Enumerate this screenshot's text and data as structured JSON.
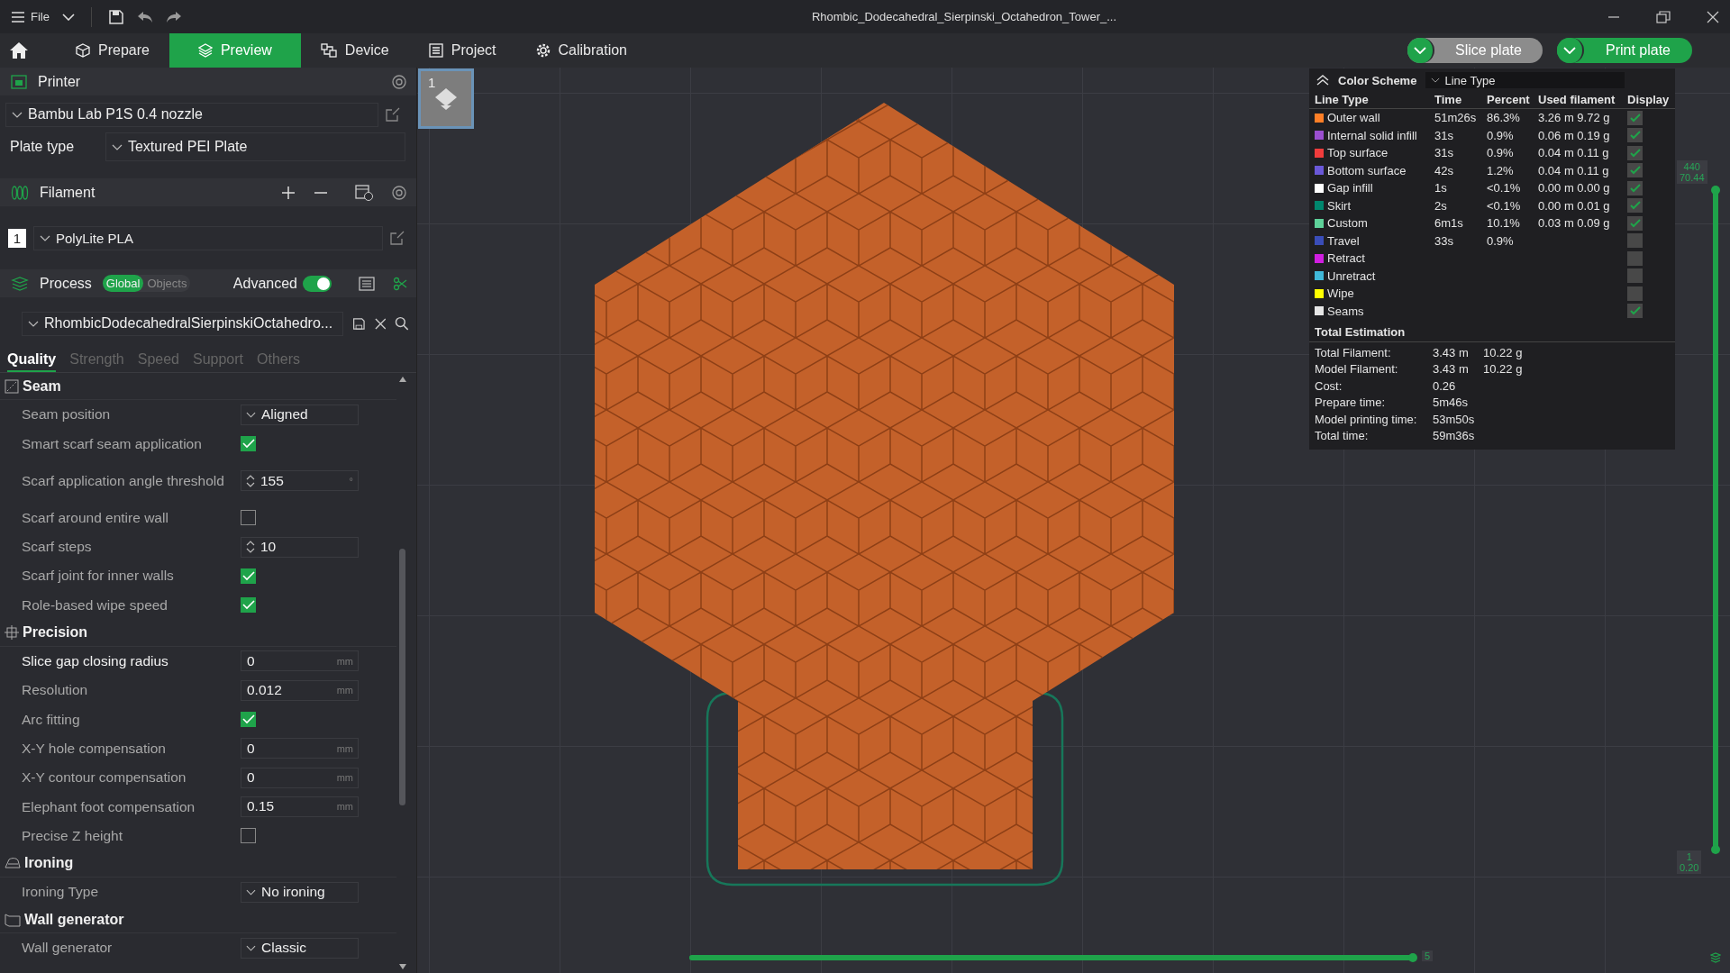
{
  "window": {
    "title": "Rhombic_Dodecahedral_Sierpinski_Octahedron_Tower_..."
  },
  "menu": {
    "label": "File"
  },
  "tabs": [
    {
      "label": "Prepare",
      "selected": false
    },
    {
      "label": "Preview",
      "selected": true
    },
    {
      "label": "Device",
      "selected": false
    },
    {
      "label": "Project",
      "selected": false
    },
    {
      "label": "Calibration",
      "selected": false
    }
  ],
  "actions": [
    {
      "label": "Slice plate",
      "kind": "secondary"
    },
    {
      "label": "Print plate",
      "kind": "primary"
    }
  ],
  "printer": {
    "title": "Printer",
    "preset": "Bambu Lab P1S 0.4 nozzle",
    "plate_type_label": "Plate type",
    "plate_type": "Textured PEI Plate"
  },
  "filament": {
    "title": "Filament",
    "items": [
      {
        "index": "1",
        "name": "PolyLite PLA"
      }
    ]
  },
  "process": {
    "title": "Process",
    "scopes": [
      {
        "label": "Global",
        "selected": true
      },
      {
        "label": "Objects",
        "selected": false
      }
    ],
    "advanced_label": "Advanced",
    "advanced_on": true,
    "preset": "RhombicDodecahedralSierpinskiOctahedro...",
    "tabs": [
      {
        "label": "Quality",
        "selected": true
      },
      {
        "label": "Strength",
        "selected": false
      },
      {
        "label": "Speed",
        "selected": false
      },
      {
        "label": "Support",
        "selected": false
      },
      {
        "label": "Others",
        "selected": false
      }
    ],
    "groups": [
      {
        "title": "Seam",
        "settings": [
          {
            "label": "Seam position",
            "kind": "select",
            "value": "Aligned",
            "highlighted": false
          },
          {
            "label": "Smart scarf seam application",
            "kind": "check",
            "checked": true,
            "highlighted": false
          },
          {
            "label": "Scarf application angle threshold",
            "kind": "spin",
            "value": "155",
            "unit": "°",
            "highlighted": false
          },
          {
            "label": "Scarf around entire wall",
            "kind": "check",
            "checked": false,
            "highlighted": false
          },
          {
            "label": "Scarf steps",
            "kind": "spin",
            "value": "10",
            "highlighted": false
          },
          {
            "label": "Scarf joint for inner walls",
            "kind": "check",
            "checked": true,
            "highlighted": false
          },
          {
            "label": "Role-based wipe speed",
            "kind": "check",
            "checked": true,
            "highlighted": false
          }
        ]
      },
      {
        "title": "Precision",
        "settings": [
          {
            "label": "Slice gap closing radius",
            "kind": "number",
            "value": "0",
            "unit": "mm",
            "highlighted": true
          },
          {
            "label": "Resolution",
            "kind": "number",
            "value": "0.012",
            "unit": "mm",
            "highlighted": false
          },
          {
            "label": "Arc fitting",
            "kind": "check",
            "checked": true,
            "highlighted": false
          },
          {
            "label": "X-Y hole compensation",
            "kind": "number",
            "value": "0",
            "unit": "mm",
            "highlighted": false
          },
          {
            "label": "X-Y contour compensation",
            "kind": "number",
            "value": "0",
            "unit": "mm",
            "highlighted": false
          },
          {
            "label": "Elephant foot compensation",
            "kind": "number",
            "value": "0.15",
            "unit": "mm",
            "highlighted": false
          },
          {
            "label": "Precise Z height",
            "kind": "check",
            "checked": false,
            "highlighted": false
          }
        ]
      },
      {
        "title": "Ironing",
        "settings": [
          {
            "label": "Ironing Type",
            "kind": "select",
            "value": "No ironing",
            "highlighted": false
          }
        ]
      },
      {
        "title": "Wall generator",
        "settings": [
          {
            "label": "Wall generator",
            "kind": "select",
            "value": "Classic",
            "highlighted": false
          }
        ]
      }
    ]
  },
  "plate": {
    "number": "1"
  },
  "legend": {
    "title": "Color Scheme",
    "scheme": "Line Type",
    "columns": [
      "Line Type",
      "Time",
      "Percent",
      "Used filament",
      "Display"
    ],
    "rows": [
      {
        "name": "Outer wall",
        "color": "#ff7f27",
        "time": "51m26s",
        "percent": "86.3%",
        "used": "3.26 m 9.72 g",
        "display": true
      },
      {
        "name": "Internal solid infill",
        "color": "#9b4fd0",
        "time": "31s",
        "percent": "0.9%",
        "used": "0.06 m 0.19 g",
        "display": true
      },
      {
        "name": "Top surface",
        "color": "#f03c3c",
        "time": "31s",
        "percent": "0.9%",
        "used": "0.04 m 0.11 g",
        "display": true
      },
      {
        "name": "Bottom surface",
        "color": "#6a58d8",
        "time": "42s",
        "percent": "1.2%",
        "used": "0.04 m 0.11 g",
        "display": true
      },
      {
        "name": "Gap infill",
        "color": "#ffffff",
        "time": "1s",
        "percent": "<0.1%",
        "used": "0.00 m 0.00 g",
        "display": true
      },
      {
        "name": "Skirt",
        "color": "#00876e",
        "time": "2s",
        "percent": "<0.1%",
        "used": "0.00 m 0.01 g",
        "display": true
      },
      {
        "name": "Custom",
        "color": "#5ed199",
        "time": "6m1s",
        "percent": "10.1%",
        "used": "0.03 m 0.09 g",
        "display": true
      },
      {
        "name": "Travel",
        "color": "#3a4db8",
        "time": "33s",
        "percent": "0.9%",
        "display": false
      },
      {
        "name": "Retract",
        "color": "#d01ee0",
        "display": false
      },
      {
        "name": "Unretract",
        "color": "#40b8d8",
        "display": false
      },
      {
        "name": "Wipe",
        "color": "#ffff00",
        "display": false
      },
      {
        "name": "Seams",
        "color": "#e6e6e6",
        "display": true
      }
    ],
    "totals_title": "Total Estimation",
    "totals": [
      {
        "label": "Total Filament:",
        "values": [
          "3.43 m",
          "10.22 g"
        ]
      },
      {
        "label": "Model Filament:",
        "values": [
          "3.43 m",
          "10.22 g"
        ]
      },
      {
        "label": "Cost:",
        "values": [
          "0.26"
        ]
      },
      {
        "label": "Prepare time:",
        "values": [
          "5m46s"
        ]
      },
      {
        "label": "Model printing time:",
        "values": [
          "53m50s"
        ]
      },
      {
        "label": "Total time:",
        "values": [
          "59m36s"
        ]
      }
    ]
  },
  "layer_slider": {
    "top_labels": [
      "440",
      "70.44"
    ],
    "bottom_labels": [
      "1",
      "0.20"
    ],
    "level": 1
  },
  "move_slider": {
    "label": "5",
    "level": 1
  }
}
